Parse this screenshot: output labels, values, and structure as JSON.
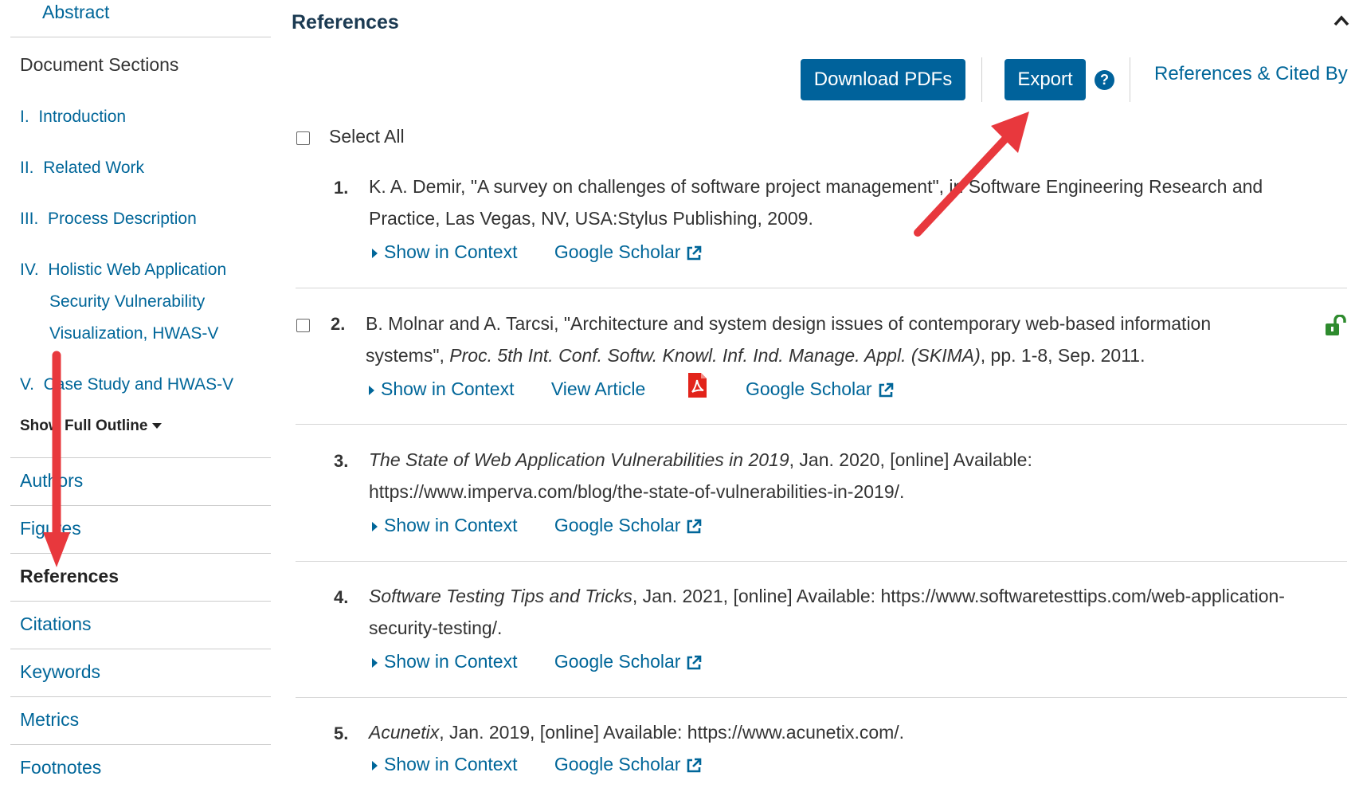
{
  "sidebar": {
    "abstract": "Abstract",
    "document_sections_title": "Document Sections",
    "sections": [
      {
        "num": "I.",
        "lines": [
          "Introduction"
        ]
      },
      {
        "num": "II.",
        "lines": [
          "Related Work"
        ]
      },
      {
        "num": "III.",
        "lines": [
          "Process Description"
        ]
      },
      {
        "num": "IV.",
        "lines": [
          "Holistic Web Application",
          "Security Vulnerability",
          "Visualization, HWAS-V"
        ]
      },
      {
        "num": "V.",
        "lines": [
          "Case Study and HWAS-V"
        ]
      }
    ],
    "show_outline": "Show Full Outline",
    "nav": [
      {
        "label": "Authors",
        "active": false
      },
      {
        "label": "Figures",
        "active": false
      },
      {
        "label": "References",
        "active": true
      },
      {
        "label": "Citations",
        "active": false
      },
      {
        "label": "Keywords",
        "active": false
      },
      {
        "label": "Metrics",
        "active": false
      },
      {
        "label": "Footnotes",
        "active": false
      }
    ]
  },
  "main": {
    "title": "References",
    "download_pdfs": "Download PDFs",
    "export": "Export",
    "help": "?",
    "refs_cited_by": "References & Cited By",
    "select_all": "Select All",
    "show_in_context": "Show in Context",
    "google_scholar": "Google Scholar",
    "view_article": "View Article",
    "references": [
      {
        "num": "1.",
        "line1": "K. A. Demir, \"A survey on challenges of software project management\", in Software Engineering Research and",
        "line2": "Practice, Las Vegas, NV, USA:Stylus Publishing, 2009."
      },
      {
        "num": "2.",
        "line1": "B. Molnar and A. Tarcsi, \"Architecture and system design issues of contemporary web-based information",
        "line2_prefix": "systems\", ",
        "line2_italic": "Proc. 5th Int. Conf. Softw. Knowl. Inf. Ind. Manage. Appl. (SKIMA)",
        "line2_suffix": ", pp. 1-8, Sep. 2011."
      },
      {
        "num": "3.",
        "line1_italic": "The State of Web Application Vulnerabilities in 2019",
        "line1_suffix": ", Jan. 2020, [online] Available:",
        "line2": "https://www.imperva.com/blog/the-state-of-vulnerabilities-in-2019/."
      },
      {
        "num": "4.",
        "line1_italic": "Software Testing Tips and Tricks",
        "line1_suffix": ", Jan. 2021, [online] Available: https://www.softwaretesttips.com/web-application-",
        "line2": "security-testing/."
      },
      {
        "num": "5.",
        "line1_italic": "Acunetix",
        "line1_suffix": ", Jan. 2019, [online] Available: https://www.acunetix.com/."
      }
    ]
  },
  "colors": {
    "link": "#006699",
    "button": "#00629b",
    "annotation_arrow": "#e8383d",
    "pdf_red": "#e2231a",
    "unlock_green": "#2e8b2e"
  },
  "icons": [
    "chevron-up-icon",
    "help-icon",
    "external-link-icon",
    "pdf-icon",
    "unlock-icon",
    "caret-right-icon",
    "caret-down-icon"
  ]
}
